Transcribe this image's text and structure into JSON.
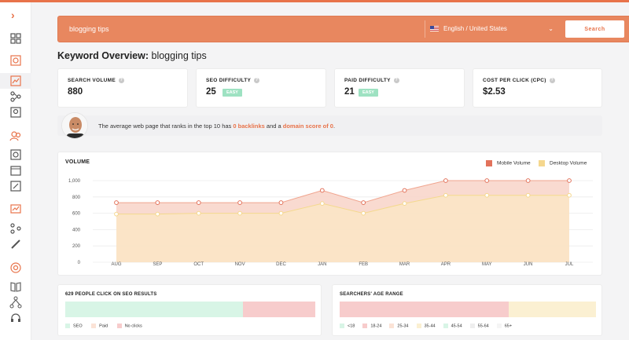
{
  "search": {
    "value": "blogging tips",
    "language": "English / United States",
    "button_label": "Search"
  },
  "overview": {
    "title_prefix": "Keyword Overview:",
    "keyword": "blogging tips"
  },
  "metrics": [
    {
      "label": "SEARCH VOLUME",
      "value": "880",
      "badge": ""
    },
    {
      "label": "SEO DIFFICULTY",
      "value": "25",
      "badge": "EASY"
    },
    {
      "label": "PAID DIFFICULTY",
      "value": "21",
      "badge": "EASY"
    },
    {
      "label": "COST PER CLICK (CPC)",
      "value": "$2.53",
      "badge": ""
    }
  ],
  "insight": {
    "prefix": "The average web page that ranks in the top 10 has ",
    "backlinks": "0 backlinks",
    "middle": " and a ",
    "domain_score": "domain score of 0",
    "suffix": "."
  },
  "colors": {
    "accent": "#e8734a",
    "mobile": "#e2725b",
    "desktop": "#f5d78e",
    "seo": "#d8f5e6",
    "paid": "#fbe3d6",
    "no_clicks": "#f7cccc"
  },
  "chart_data": {
    "type": "area",
    "title": "VOLUME",
    "categories": [
      "AUG",
      "SEP",
      "OCT",
      "NOV",
      "DEC",
      "JAN",
      "FEB",
      "MAR",
      "APR",
      "MAY",
      "JUN",
      "JUL"
    ],
    "series": [
      {
        "name": "Mobile Volume",
        "values": [
          730,
          730,
          730,
          730,
          730,
          880,
          730,
          880,
          1000,
          1000,
          1000,
          1000
        ]
      },
      {
        "name": "Desktop Volume",
        "values": [
          590,
          590,
          600,
          600,
          600,
          720,
          600,
          720,
          820,
          820,
          820,
          820
        ]
      }
    ],
    "y_ticks": [
      "0",
      "200",
      "400",
      "600",
      "800",
      "1,000"
    ],
    "ylim": [
      0,
      1000
    ],
    "grid": true,
    "legend_position": "top-right"
  },
  "clicks": {
    "title": "629 PEOPLE CLICK ON SEO RESULTS",
    "segments": [
      {
        "label": "SEO",
        "fraction": 0.71
      },
      {
        "label": "Paid",
        "fraction": 0.0
      },
      {
        "label": "No clicks",
        "fraction": 0.29
      }
    ]
  },
  "age": {
    "title": "SEARCHERS' AGE RANGE",
    "segments": [
      {
        "label": "<18",
        "fraction": 0.0
      },
      {
        "label": "18-24",
        "fraction": 0.66
      },
      {
        "label": "25-34",
        "fraction": 0.0
      },
      {
        "label": "35-44",
        "fraction": 0.34
      },
      {
        "label": "45-54",
        "fraction": 0.0
      },
      {
        "label": "55-64",
        "fraction": 0.0
      },
      {
        "label": "65+",
        "fraction": 0.0
      }
    ],
    "legend_colors": [
      "#d8f5e6",
      "#f7cccc",
      "#fbe3d6",
      "#fbf0d2",
      "#d8f5e6",
      "#eeeeee",
      "#f5f5f5"
    ]
  }
}
